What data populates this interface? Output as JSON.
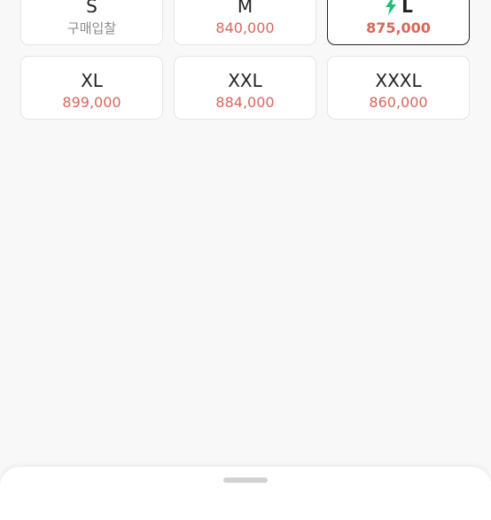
{
  "sizes": [
    {
      "label": "S",
      "price": "구매입찰",
      "price_muted": true,
      "selected": false,
      "express": false
    },
    {
      "label": "M",
      "price": "840,000",
      "price_muted": false,
      "selected": false,
      "express": false
    },
    {
      "label": "L",
      "price": "875,000",
      "price_muted": false,
      "selected": true,
      "express": true
    },
    {
      "label": "XL",
      "price": "899,000",
      "price_muted": false,
      "selected": false,
      "express": false
    },
    {
      "label": "XXL",
      "price": "884,000",
      "price_muted": false,
      "selected": false,
      "express": false
    },
    {
      "label": "XXXL",
      "price": "860,000",
      "price_muted": false,
      "selected": false,
      "express": false
    }
  ],
  "icons": {
    "express": "lightning-bolt-icon"
  },
  "colors": {
    "price": "#d9665b",
    "muted_price": "#8a8a8a",
    "express_icon": "#1dbf73",
    "selected_border": "#222222"
  }
}
